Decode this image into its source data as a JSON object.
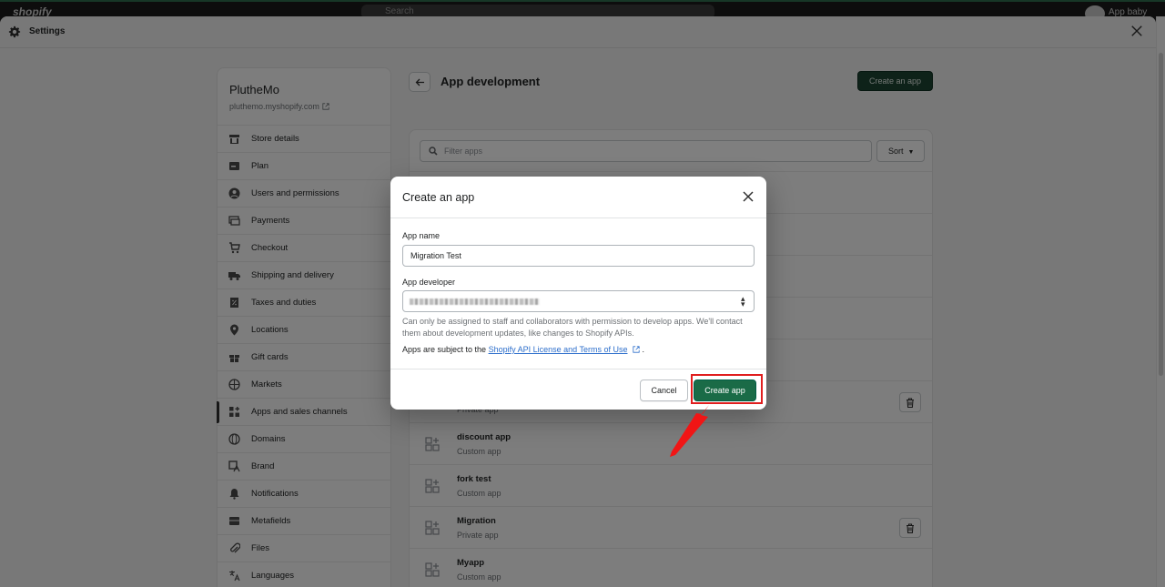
{
  "topbar": {
    "logo": "shopify",
    "search_placeholder": "Search",
    "user": "App baby"
  },
  "settings": {
    "title": "Settings"
  },
  "store": {
    "name": "PlutheMo",
    "url": "pluthemo.myshopify.com"
  },
  "nav": [
    {
      "label": "Store details",
      "icon": "store-icon"
    },
    {
      "label": "Plan",
      "icon": "plan-icon"
    },
    {
      "label": "Users and permissions",
      "icon": "user-icon"
    },
    {
      "label": "Payments",
      "icon": "payments-icon"
    },
    {
      "label": "Checkout",
      "icon": "cart-icon"
    },
    {
      "label": "Shipping and delivery",
      "icon": "truck-icon"
    },
    {
      "label": "Taxes and duties",
      "icon": "tax-icon"
    },
    {
      "label": "Locations",
      "icon": "location-icon"
    },
    {
      "label": "Gift cards",
      "icon": "gift-icon"
    },
    {
      "label": "Markets",
      "icon": "globe-icon"
    },
    {
      "label": "Apps and sales channels",
      "icon": "apps-icon"
    },
    {
      "label": "Domains",
      "icon": "domain-icon"
    },
    {
      "label": "Brand",
      "icon": "brand-icon"
    },
    {
      "label": "Notifications",
      "icon": "bell-icon"
    },
    {
      "label": "Metafields",
      "icon": "metafields-icon"
    },
    {
      "label": "Files",
      "icon": "paperclip-icon"
    },
    {
      "label": "Languages",
      "icon": "translate-icon"
    }
  ],
  "page": {
    "title": "App development",
    "create_button": "Create an app"
  },
  "filter": {
    "placeholder": "Filter apps",
    "sort_label": "Sort"
  },
  "apps": [
    {
      "name": "",
      "type": "Private app"
    },
    {
      "name": "discount app",
      "type": "Custom app"
    },
    {
      "name": "fork test",
      "type": "Custom app"
    },
    {
      "name": "Migration",
      "type": "Private app"
    },
    {
      "name": "Myapp",
      "type": "Custom app"
    }
  ],
  "modal": {
    "title": "Create an app",
    "app_name_label": "App name",
    "app_name_value": "Migration Test",
    "developer_label": "App developer",
    "help_text": "Can only be assigned to staff and collaborators with permission to develop apps. We'll contact them about development updates, like changes to Shopify APIs.",
    "terms_prefix": "Apps are subject to the ",
    "terms_link": "Shopify API License and Terms of Use",
    "terms_suffix": " .",
    "cancel_label": "Cancel",
    "create_label": "Create app"
  },
  "colors": {
    "primary": "#1a6b47",
    "highlight": "#e01e1e",
    "link": "#2c6ecb"
  }
}
